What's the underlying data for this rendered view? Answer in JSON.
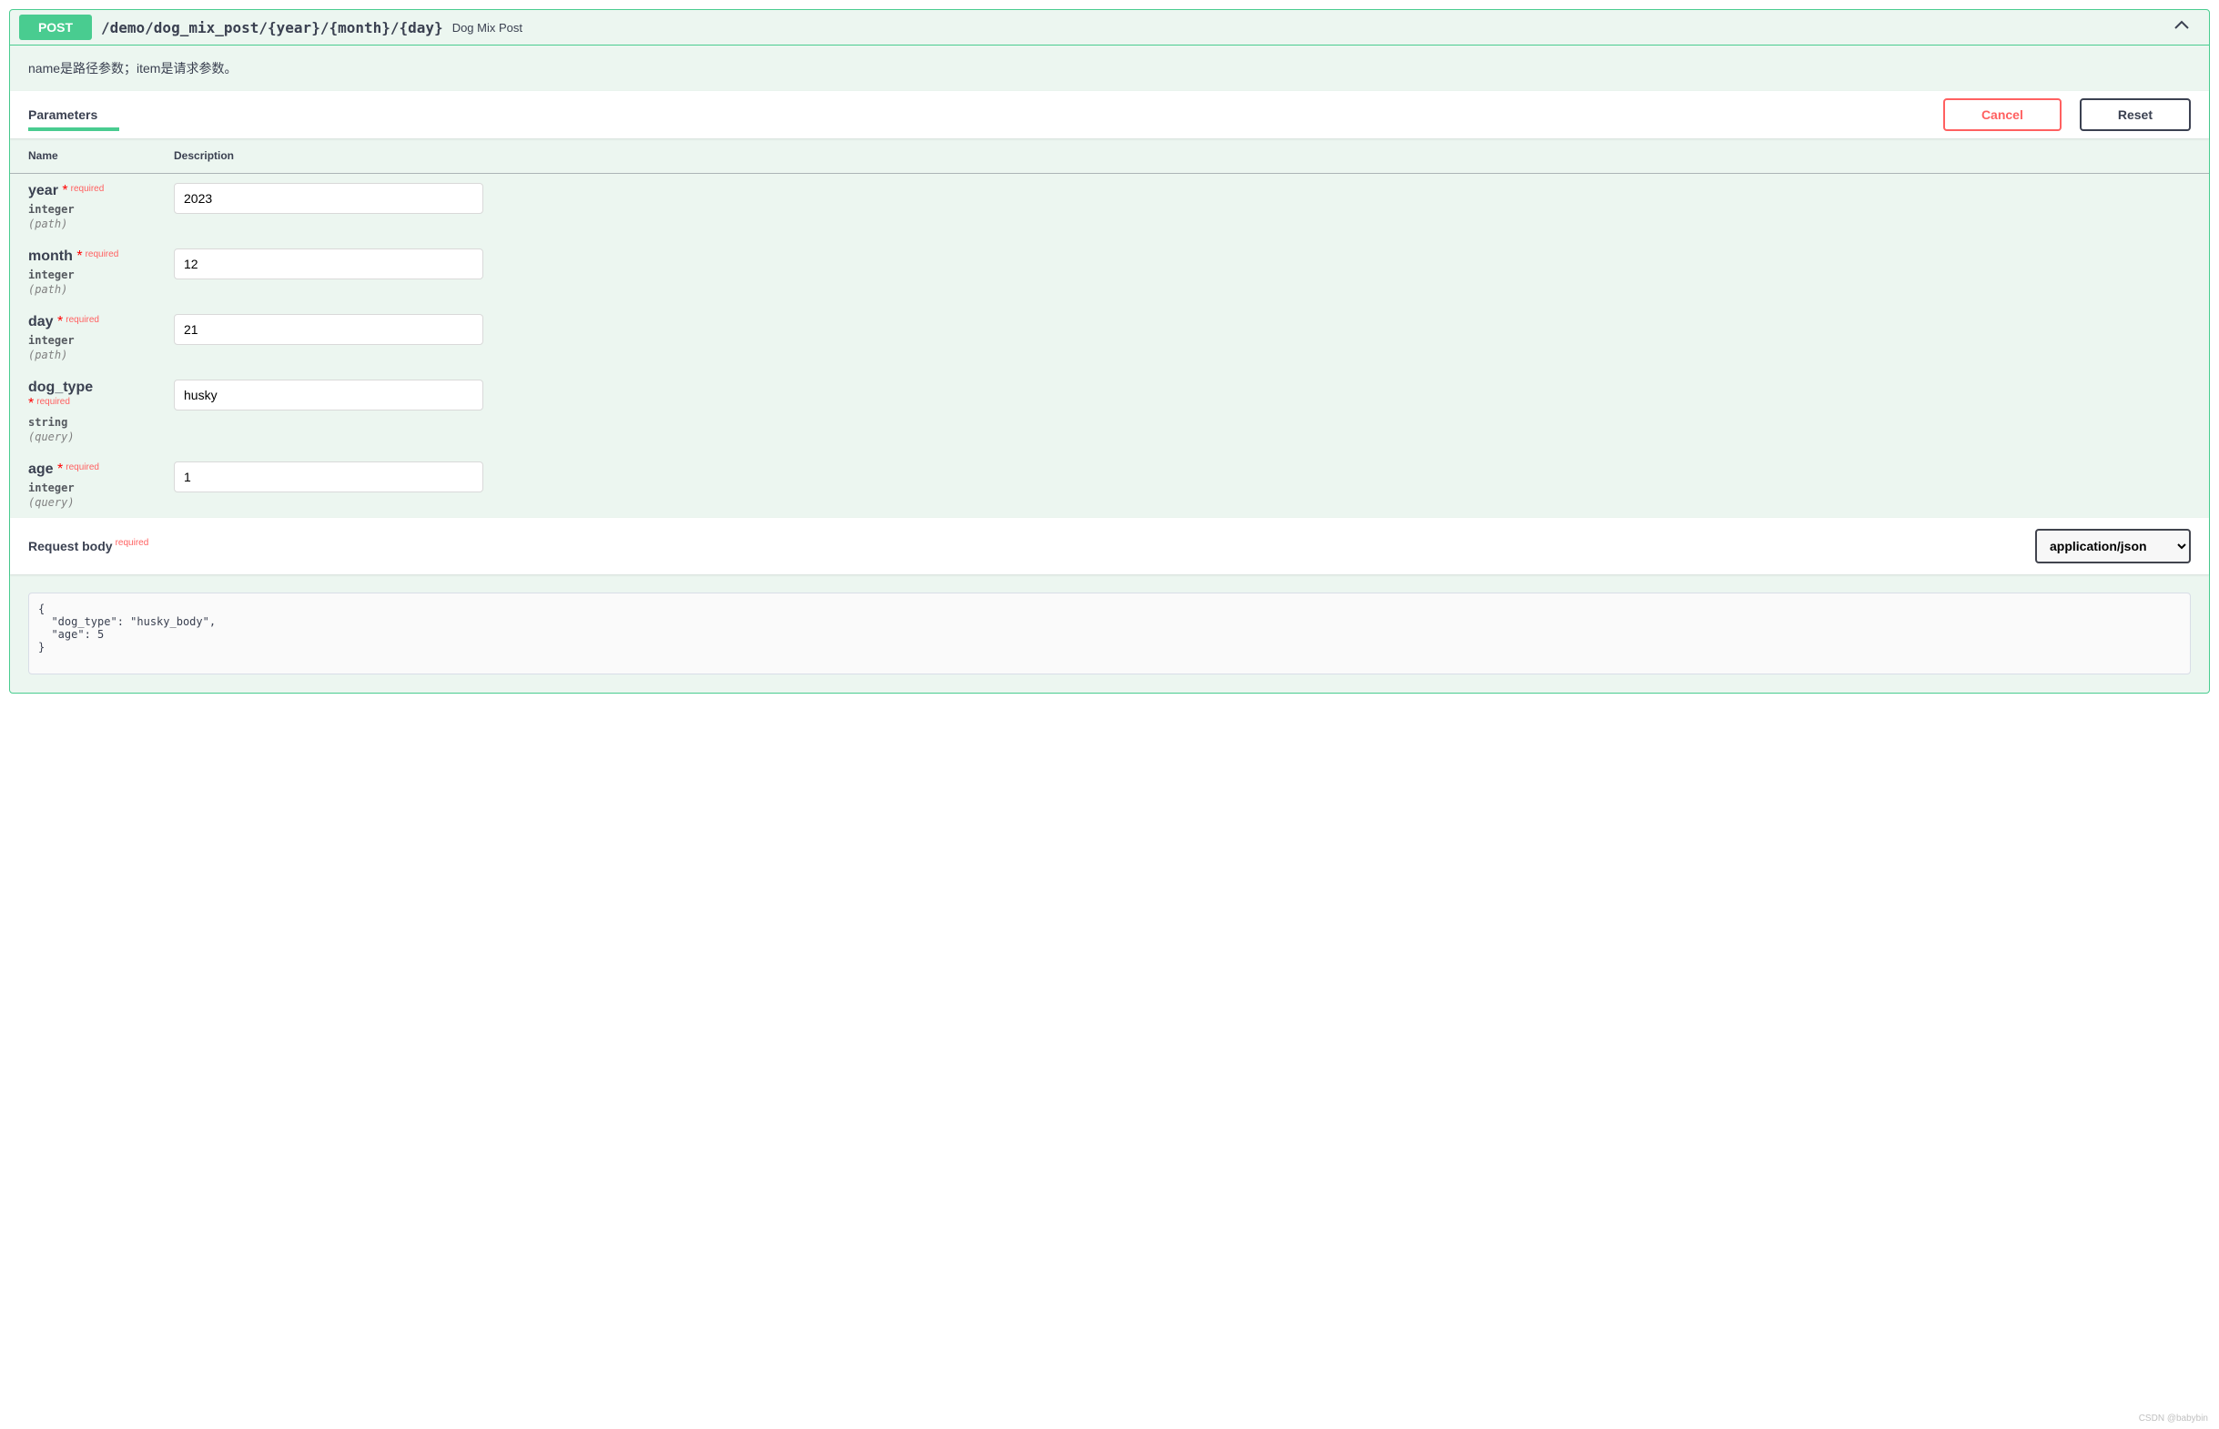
{
  "opblock": {
    "method": "POST",
    "path": "/demo/dog_mix_post/{year}/{month}/{day}",
    "summary": "Dog Mix Post",
    "description": "name是路径参数；item是请求参数。"
  },
  "section": {
    "parameters_label": "Parameters",
    "cancel_label": "Cancel",
    "reset_label": "Reset"
  },
  "columns": {
    "name": "Name",
    "description": "Description"
  },
  "params": [
    {
      "name": "year",
      "required_label": "required",
      "type": "integer",
      "in": "(path)",
      "value": "2023"
    },
    {
      "name": "month",
      "required_label": "required",
      "type": "integer",
      "in": "(path)",
      "value": "12"
    },
    {
      "name": "day",
      "required_label": "required",
      "type": "integer",
      "in": "(path)",
      "value": "21"
    },
    {
      "name": "dog_type",
      "required_label": "required",
      "type": "string",
      "in": "(query)",
      "value": "husky"
    },
    {
      "name": "age",
      "required_label": "required",
      "type": "integer",
      "in": "(query)",
      "value": "1"
    }
  ],
  "request_body": {
    "title": "Request body",
    "required_label": "required",
    "content_type": "application/json",
    "payload": "{\n  \"dog_type\": \"husky_body\",\n  \"age\": 5\n}"
  },
  "watermark": "CSDN @babybin"
}
